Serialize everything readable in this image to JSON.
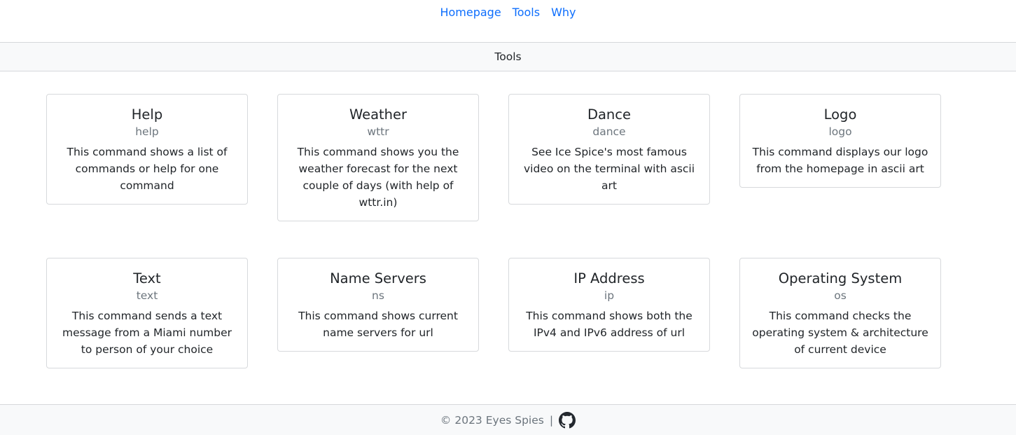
{
  "nav": {
    "links": [
      "Homepage",
      "Tools",
      "Why"
    ]
  },
  "section": {
    "title": "Tools"
  },
  "tools": [
    {
      "title": "Help",
      "command": "help",
      "description": "This command shows a list of commands or help for one command"
    },
    {
      "title": "Weather",
      "command": "wttr",
      "description": "This command shows you the weather forecast for the next couple of days (with help of wttr.in)"
    },
    {
      "title": "Dance",
      "command": "dance",
      "description": "See Ice Spice's most famous video on the terminal with ascii art"
    },
    {
      "title": "Logo",
      "command": "logo",
      "description": "This command displays our logo from the homepage in ascii art"
    },
    {
      "title": "Text",
      "command": "text",
      "description": "This command sends a text message from a Miami number to person of your choice"
    },
    {
      "title": "Name Servers",
      "command": "ns",
      "description": "This command shows current name servers for url"
    },
    {
      "title": "IP Address",
      "command": "ip",
      "description": "This command shows both the IPv4 and IPv6 address of url"
    },
    {
      "title": "Operating System",
      "command": "os",
      "description": "This command checks the operating system & architecture of current device"
    }
  ],
  "footer": {
    "copyright": "© 2023 Eyes Spies",
    "separator": "|",
    "github_icon": "github-icon"
  }
}
